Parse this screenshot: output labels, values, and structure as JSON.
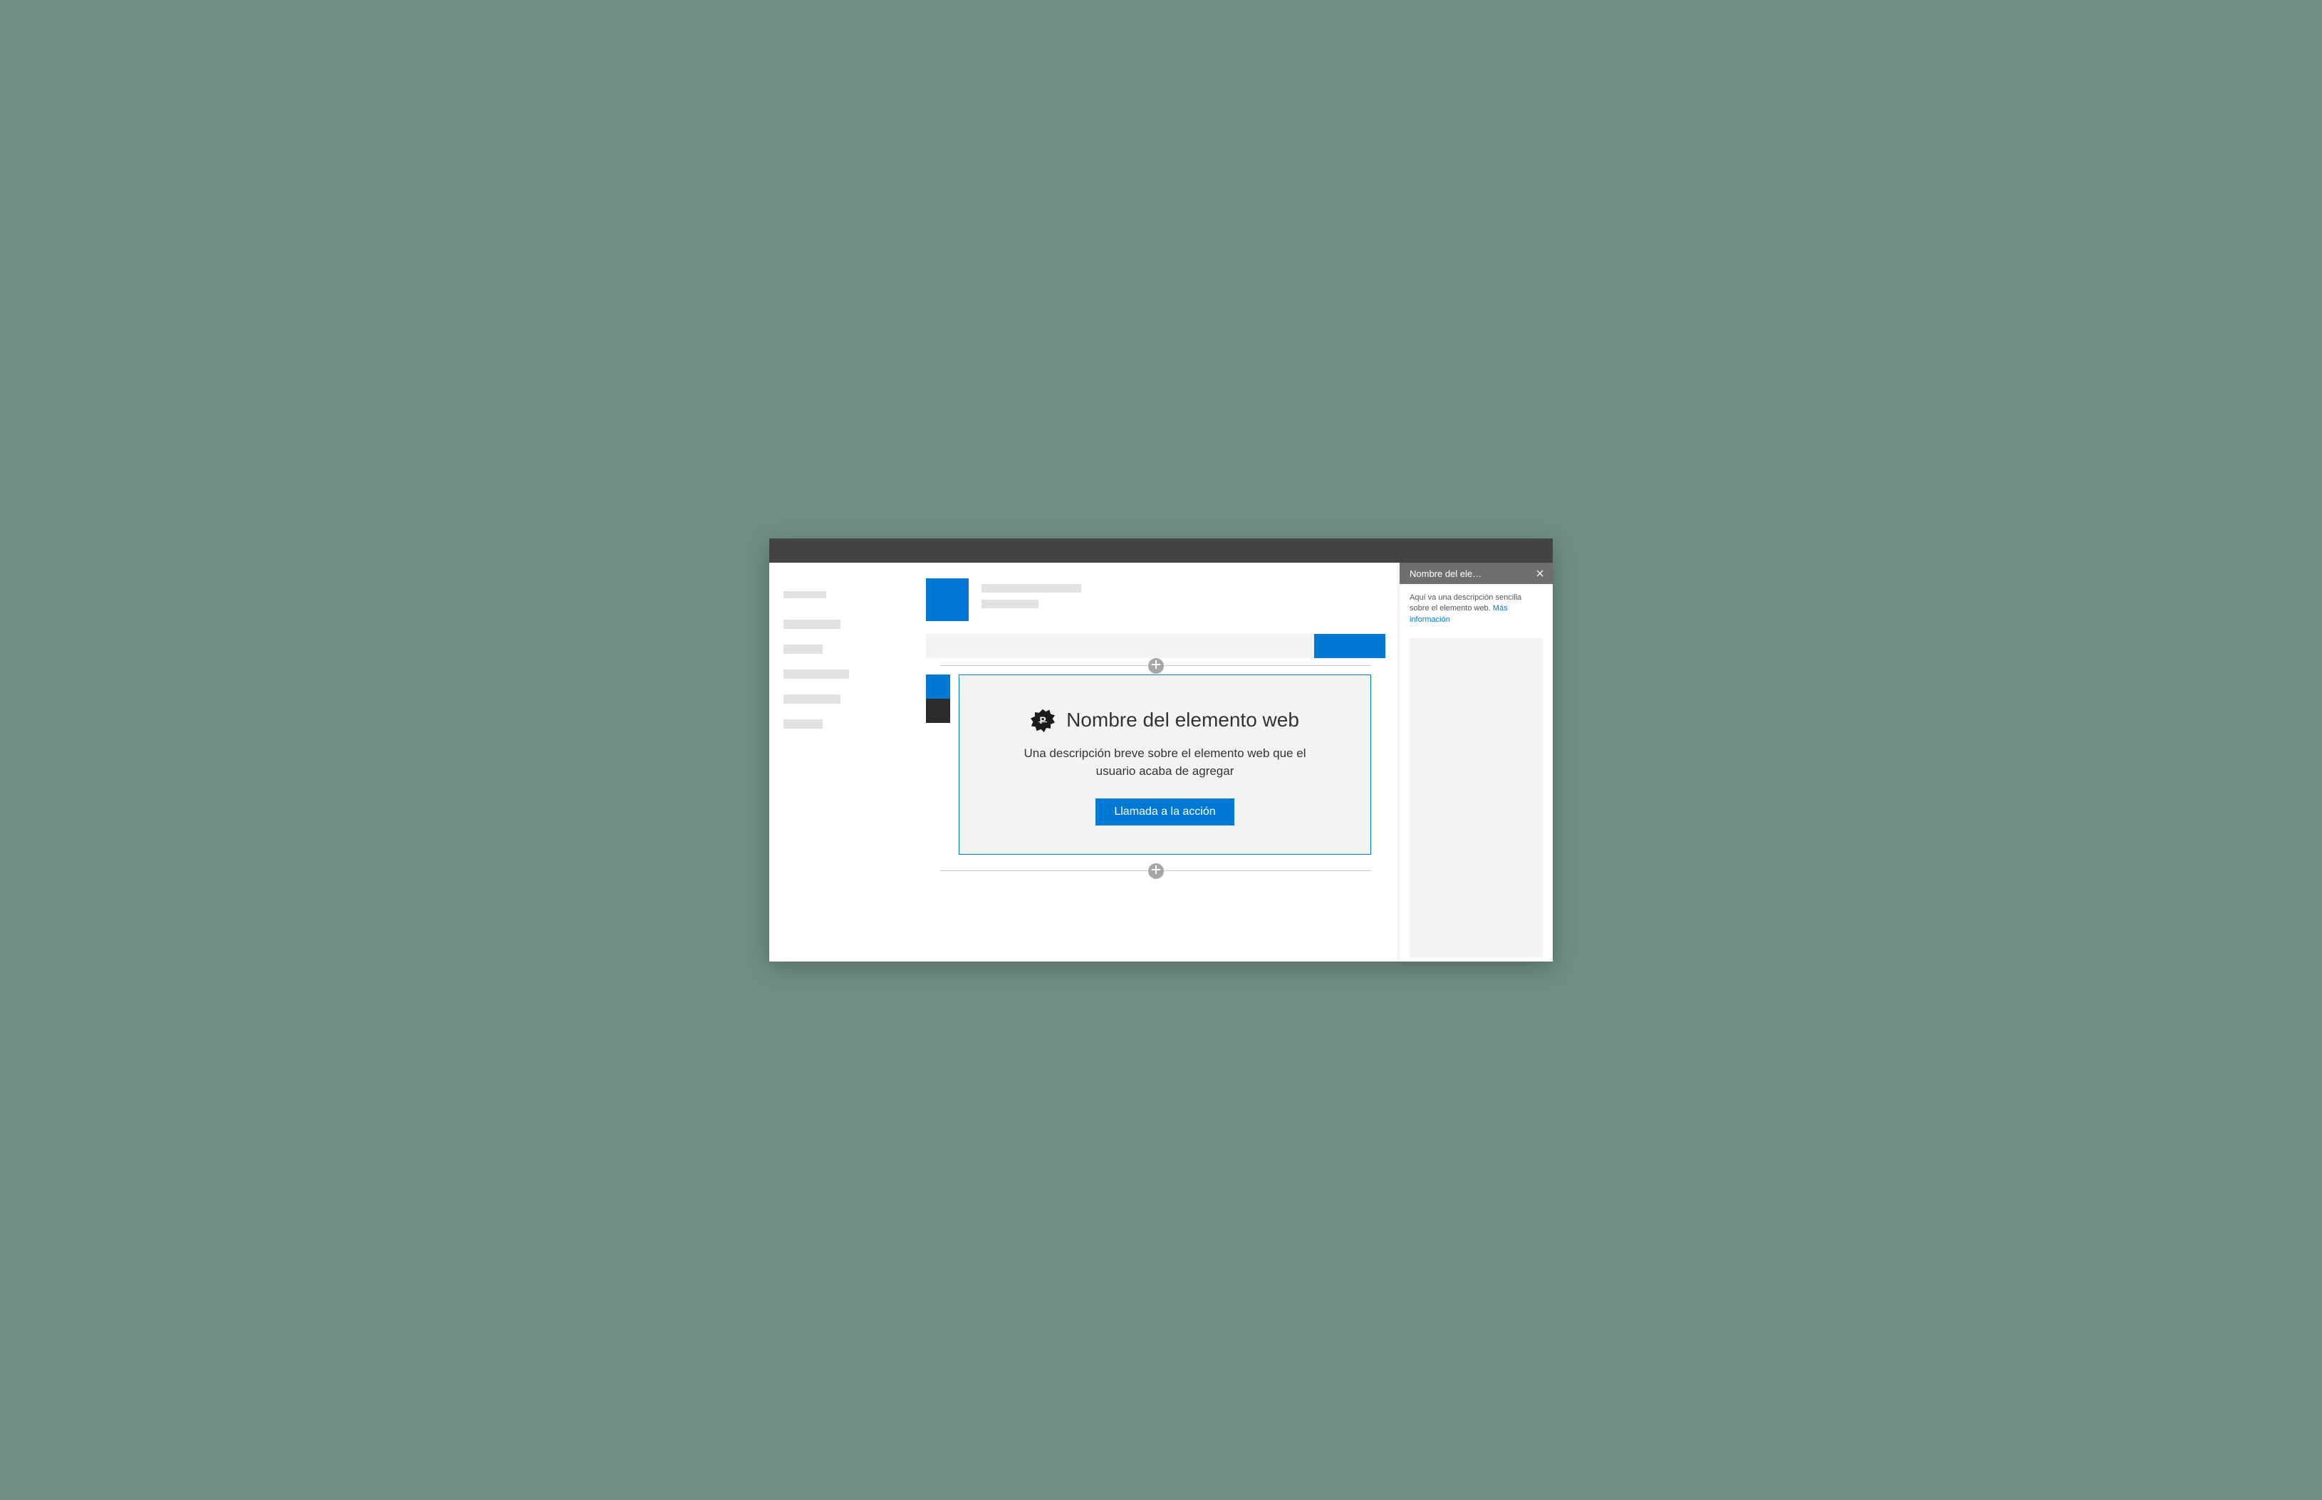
{
  "colors": {
    "accent": "#0078d4",
    "backdrop": "#6f8f86",
    "titlebar": "#444444",
    "panel_header": "#6f6f6f"
  },
  "webpart": {
    "icon_letter": "P",
    "title": "Nombre del elemento web",
    "description": "Una descripción breve sobre el elemento web que el usuario acaba de agregar",
    "cta_label": "Llamada a la acción"
  },
  "panel": {
    "title": "Nombre del ele…",
    "description_prefix": "Aquí va una descripción sencilla sobre el elemento web. ",
    "more_info_label": "Más información"
  }
}
